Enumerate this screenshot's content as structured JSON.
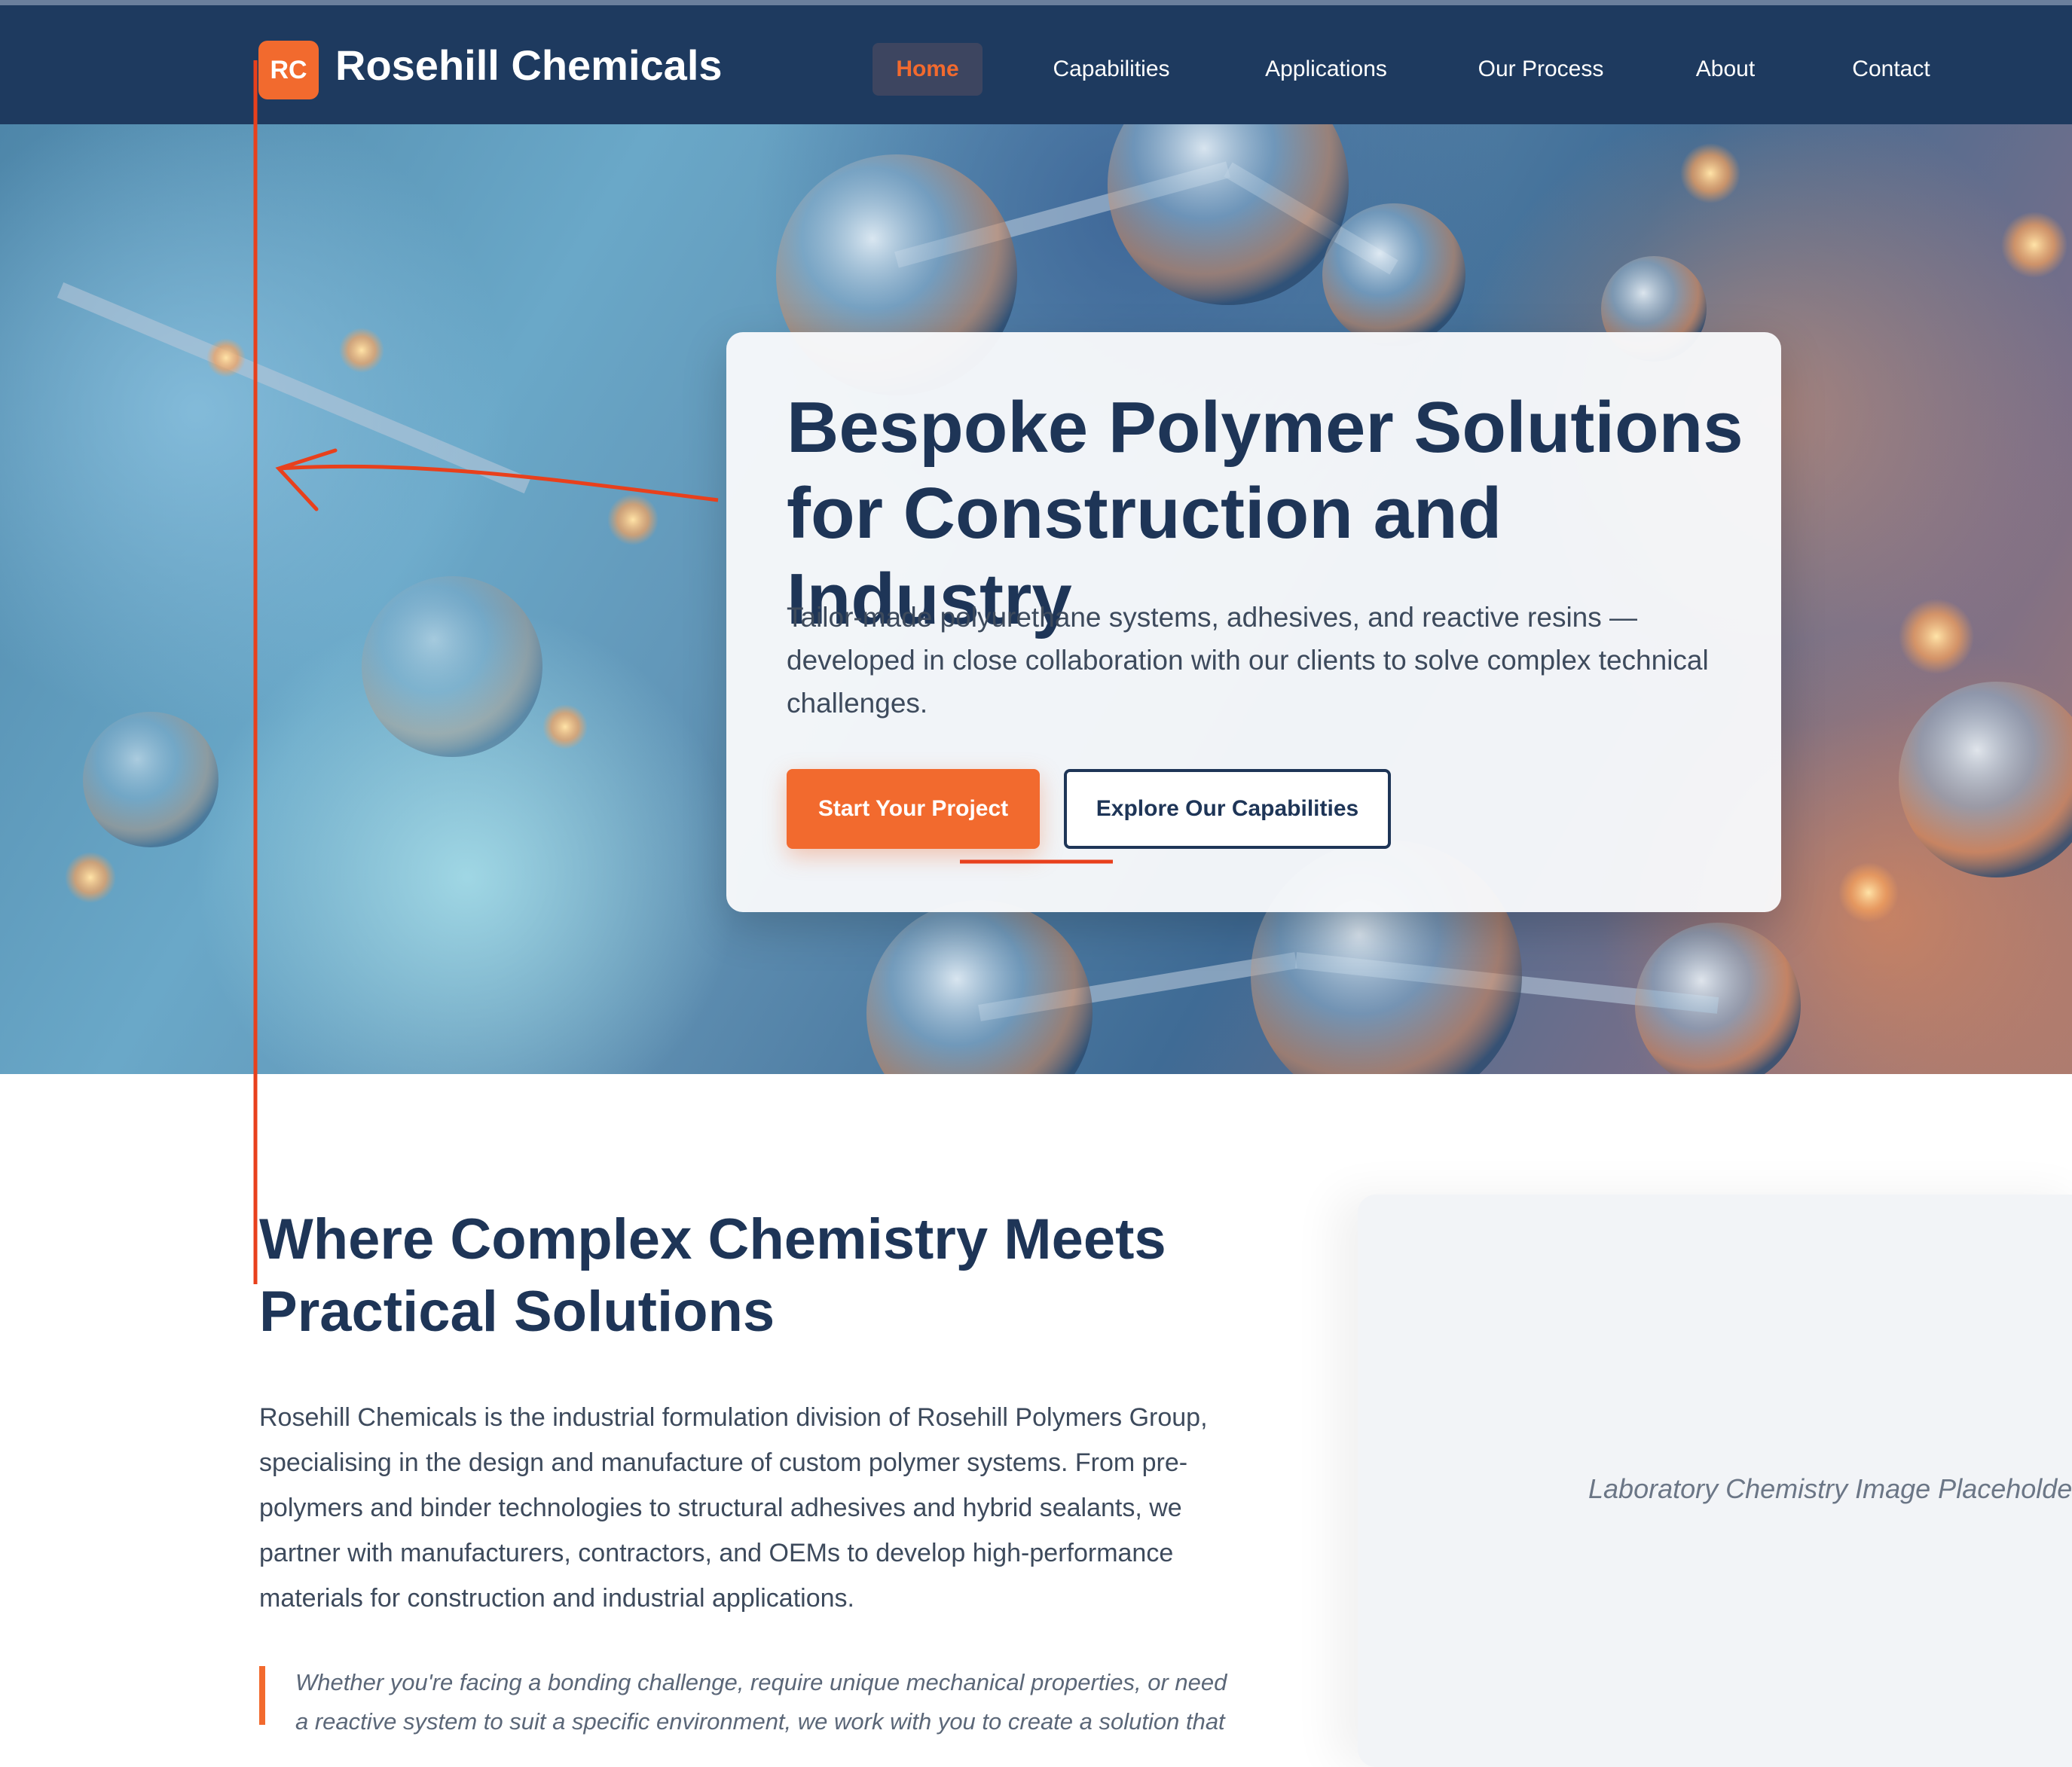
{
  "colors": {
    "nav_bg": "#1e3a5f",
    "accent": "#f26a2e",
    "heading": "#1e3557",
    "body_text": "#3d4a5c",
    "annotation": "#e8401c"
  },
  "nav": {
    "logo_badge": "RC",
    "logo_text": "Rosehill Chemicals",
    "items": [
      {
        "label": "Home",
        "active": true
      },
      {
        "label": "Capabilities",
        "active": false
      },
      {
        "label": "Applications",
        "active": false
      },
      {
        "label": "Our Process",
        "active": false
      },
      {
        "label": "About",
        "active": false
      },
      {
        "label": "Contact",
        "active": false
      }
    ]
  },
  "hero": {
    "title": "Bespoke Polymer Solutions for Construction and Industry",
    "subtitle": "Tailor-made polyurethane systems, adhesives, and reactive resins — developed in close collaboration with our clients to solve complex technical challenges.",
    "primary_button": "Start Your Project",
    "secondary_button": "Explore Our Capabilities",
    "background_image": "molecular-bubbles-image"
  },
  "about": {
    "title": "Where Complex Chemistry Meets Practical Solutions",
    "body": "Rosehill Chemicals is the industrial formulation division of Rosehill Polymers Group, specialising in the design and manufacture of custom polymer systems. From pre-polymers and binder technologies to structural adhesives and hybrid sealants, we partner with manufacturers, contractors, and OEMs to develop high-performance materials for construction and industrial applications.",
    "quote": "Whether you're facing a bonding challenge, require unique mechanical properties, or need a reactive system to suit a specific environment, we work with you to create a solution that",
    "image_placeholder": "Laboratory Chemistry Image Placeholder"
  },
  "annotations": {
    "type": "hand-drawn-markup",
    "marks": [
      "alignment-line",
      "arrow",
      "underline"
    ]
  }
}
